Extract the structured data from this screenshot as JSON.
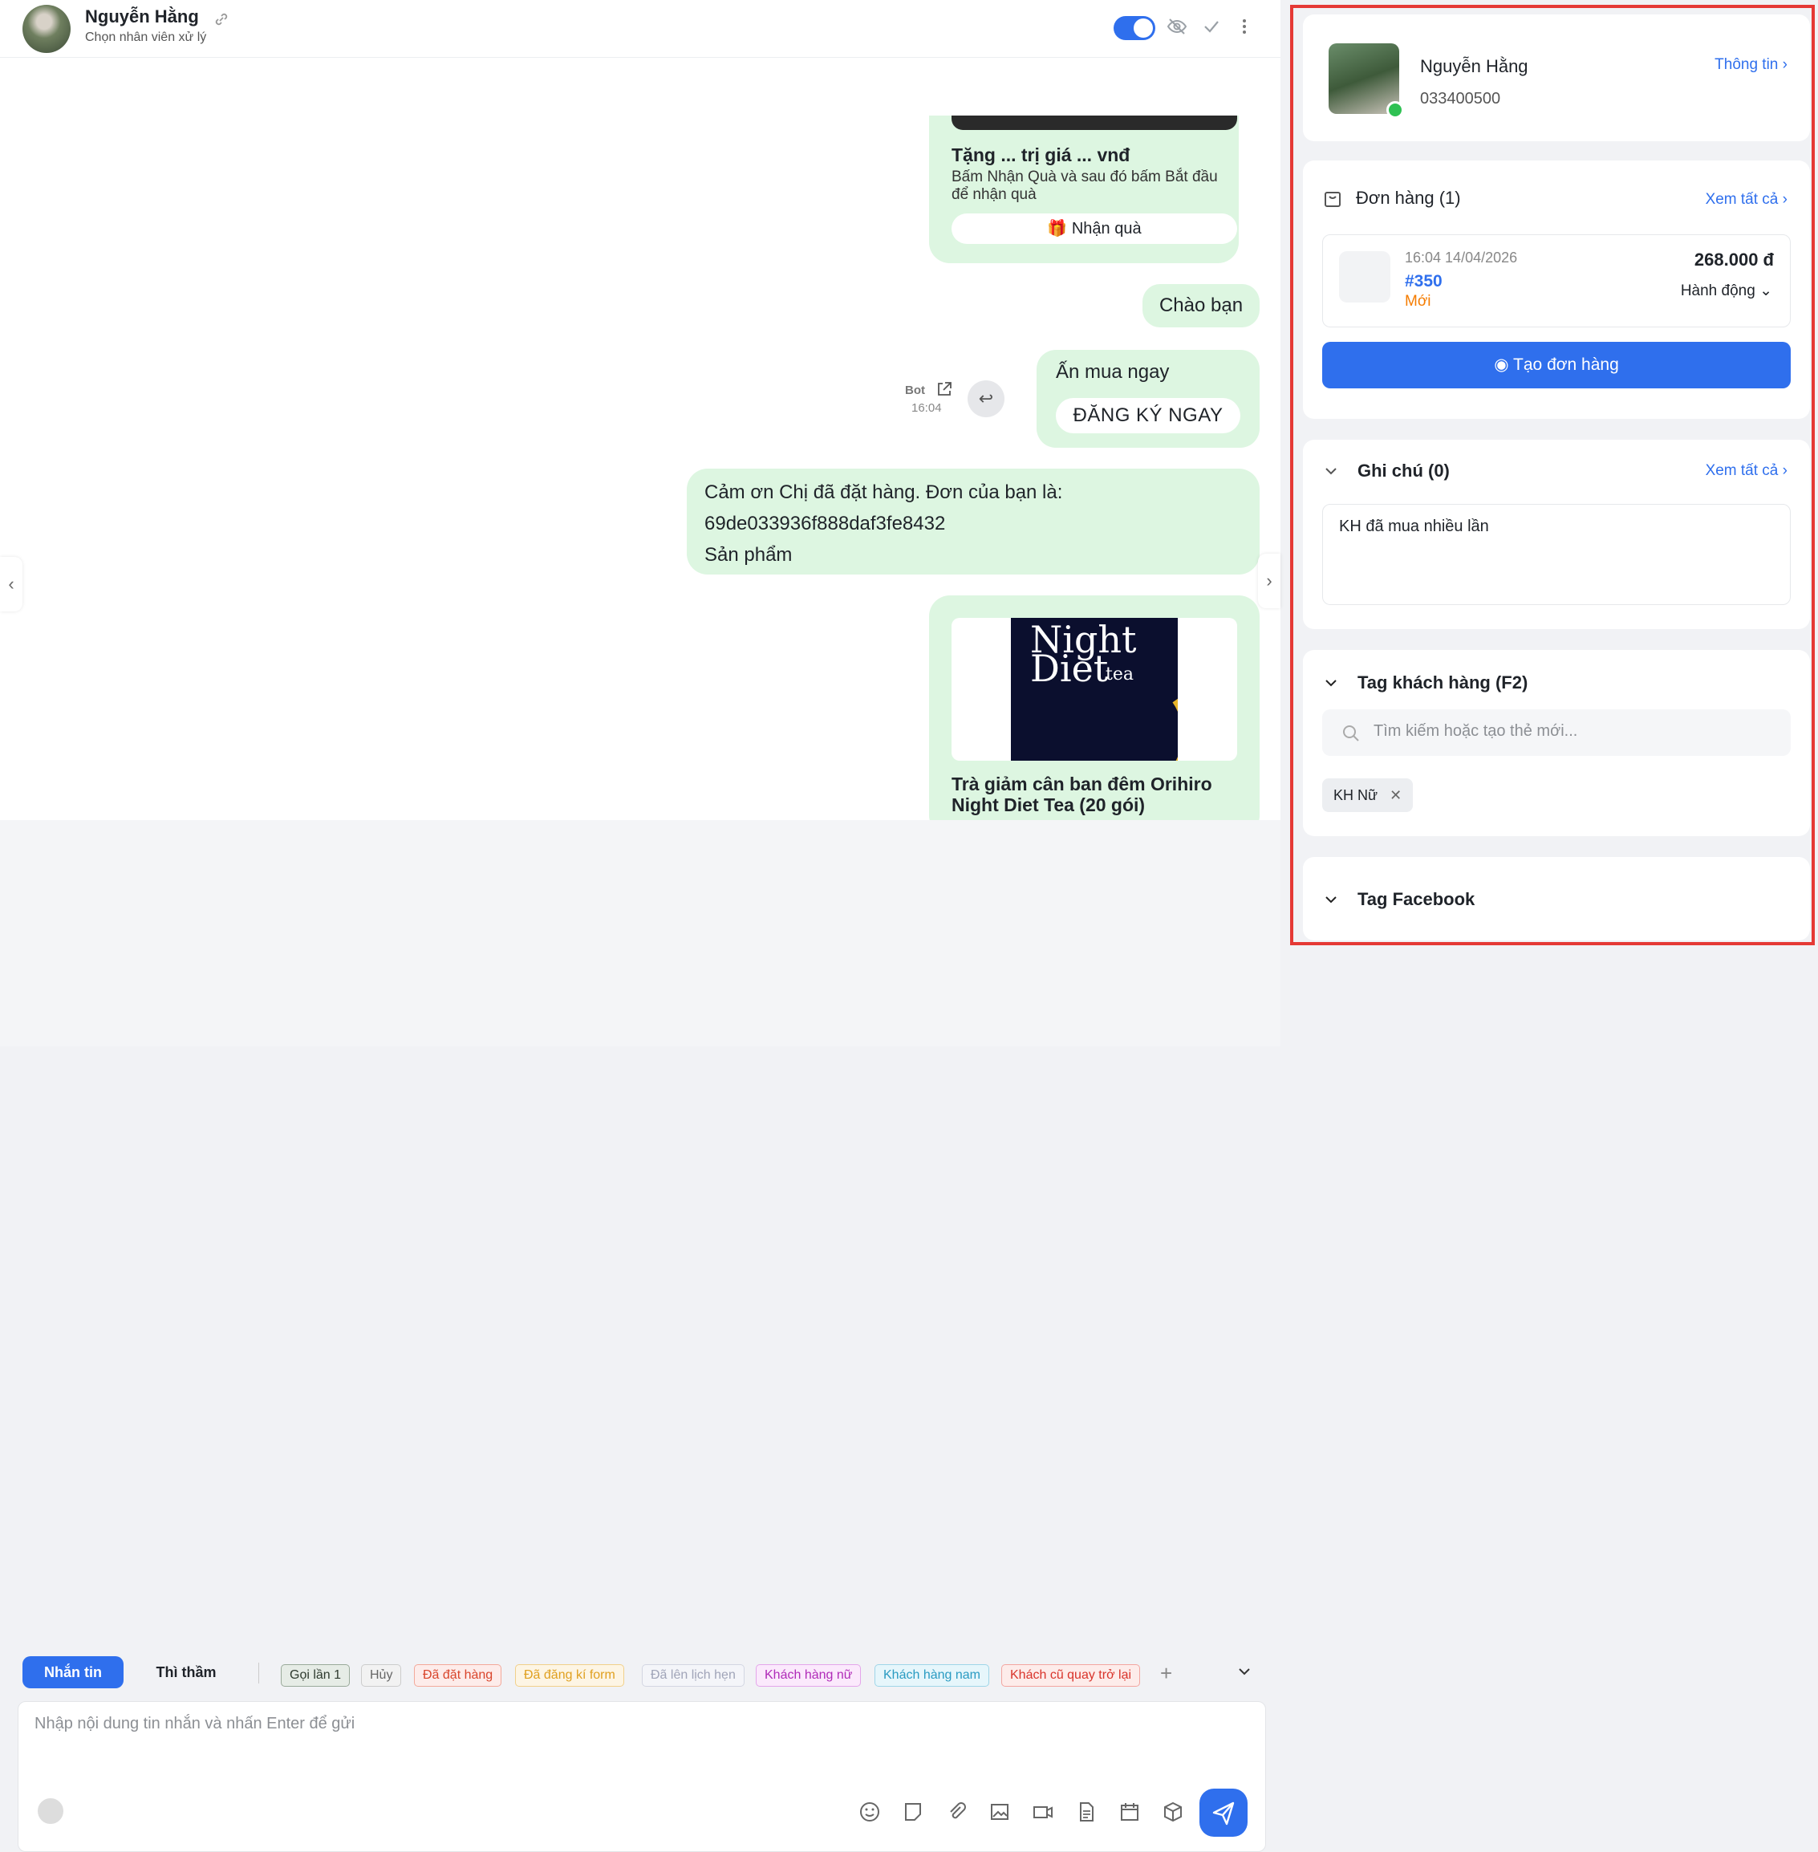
{
  "header": {
    "name": "Nguyễn Hằng",
    "subtitle": "Chọn nhân viên xử lý"
  },
  "messages": {
    "promo_title": "Tặng ... trị giá ... vnđ",
    "promo_desc": "Bấm Nhận Quà và sau đó bấm Bắt đầu để nhận quà",
    "promo_button": "🎁 Nhận quà",
    "greeting": "Chào bạn",
    "buy_text": "Ấn mua ngay",
    "buy_button": "ĐĂNG KÝ NGAY",
    "bot_label": "Bot",
    "bot_time": "16:04",
    "thanks_line1": "Cảm ơn Chị đã đặt hàng. Đơn của bạn là:",
    "thanks_line2": "69de033936f888daf3fe8432",
    "thanks_line3": "Sản phẩm",
    "product_image_text": {
      "line1": "Night",
      "line2": "Diet",
      "line3": "tea"
    },
    "product_name": "Trà giảm cân ban đêm Orihiro Night Diet Tea (20 gói)"
  },
  "composer": {
    "tab_active": "Nhắn tin",
    "tab_whisper": "Thì thầm",
    "tags": [
      {
        "label": "Gọi lần 1",
        "color": "#2e3a2e",
        "bg": "#e6ece6",
        "border": "#9aaa9a"
      },
      {
        "label": "Hủy",
        "color": "#666",
        "bg": "#f2f2f2",
        "border": "#ccc"
      },
      {
        "label": "Đã đặt hàng",
        "color": "#d9452b",
        "bg": "#fdecea",
        "border": "#f3a99a"
      },
      {
        "label": "Đã đăng kí form",
        "color": "#e0a020",
        "bg": "#fdf5e4",
        "border": "#f1d08a"
      },
      {
        "label": "Đã lên lịch hẹn",
        "color": "#a0a4b8",
        "bg": "#f4f5f9",
        "border": "#d3d6e2"
      },
      {
        "label": "Khách hàng nữ",
        "color": "#b02bb8",
        "bg": "#fbe9fc",
        "border": "#e4a6ea"
      },
      {
        "label": "Khách hàng nam",
        "color": "#2a9bc2",
        "bg": "#e6f6fb",
        "border": "#9fd6e8"
      },
      {
        "label": "Khách cũ quay trở lại",
        "color": "#d9342b",
        "bg": "#fdecea",
        "border": "#f3a6a0"
      }
    ],
    "placeholder": "Nhập nội dung tin nhắn và nhấn Enter để gửi"
  },
  "customer": {
    "name": "Nguyễn Hằng",
    "phone": "033400500",
    "info_link": "Thông tin"
  },
  "orders": {
    "title": "Đơn hàng (1)",
    "view_all": "Xem tất cả",
    "item": {
      "date": "16:04 14/04/2026",
      "id": "#350",
      "status": "Mới",
      "amount": "268.000 đ",
      "action": "Hành động"
    },
    "create_button": "Tạo đơn hàng"
  },
  "notes": {
    "title": "Ghi chú (0)",
    "view_all": "Xem tất cả",
    "content": "KH đã mua nhiều lần"
  },
  "customer_tags": {
    "title": "Tag khách hàng (F2)",
    "search_placeholder": "Tìm kiếm hoặc tạo thẻ mới...",
    "chips": [
      "KH Nữ"
    ]
  },
  "facebook_tags": {
    "title": "Tag Facebook"
  },
  "colors": {
    "accent": "#2f6fed",
    "bubble": "#ddf6e1",
    "highlight_border": "#e53935"
  }
}
